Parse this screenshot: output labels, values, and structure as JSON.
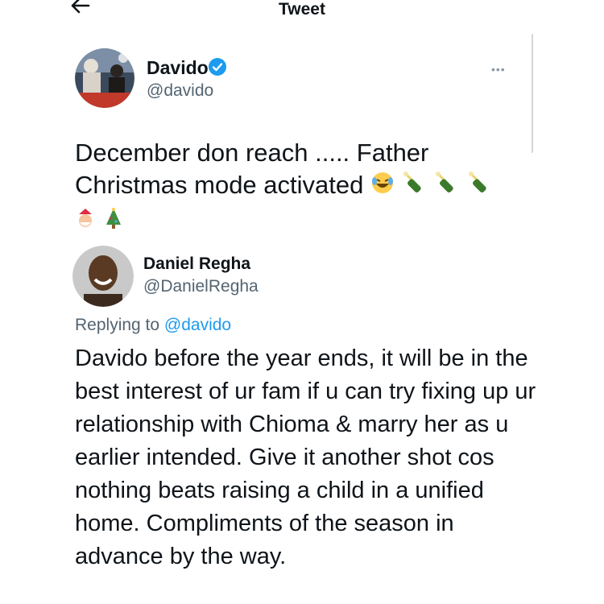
{
  "header": {
    "title": "Tweet"
  },
  "main_tweet": {
    "display_name": "Davido",
    "handle": "@davido",
    "text": "December don reach ..... Father Christmas mode activated",
    "emoji": [
      "laughing-face",
      "champagne",
      "champagne",
      "champagne",
      "santa",
      "christmas-tree"
    ]
  },
  "reply": {
    "display_name": "Daniel Regha",
    "handle": "@DanielRegha",
    "replying_prefix": "Replying to",
    "replying_target": "@davido",
    "text": "Davido before the year ends, it will be in the best interest of ur fam if u can try fixing up ur relationship with Chioma & marry her as u earlier intended. Give it another shot cos nothing beats raising a child in a unified home. Compliments of the season in advance by the way."
  },
  "colors": {
    "verified": "#1d9bf0",
    "link": "#1d9bf0",
    "muted": "#536471"
  }
}
